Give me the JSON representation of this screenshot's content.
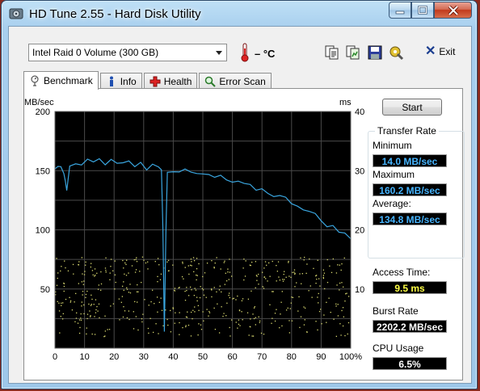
{
  "window": {
    "title": "HD Tune 2.55 - Hard Disk Utility"
  },
  "toolbar": {
    "drive": "Intel   Raid 0 Volume (300 GB)",
    "temperature": "– °C",
    "exit_label": "Exit",
    "icons": [
      "copy-text-icon",
      "copy-image-icon",
      "save-icon",
      "options-icon"
    ]
  },
  "tabs": [
    {
      "label": "Benchmark",
      "icon": "benchmark-icon",
      "active": true
    },
    {
      "label": "Info",
      "icon": "info-icon",
      "active": false
    },
    {
      "label": "Health",
      "icon": "health-icon",
      "active": false
    },
    {
      "label": "Error Scan",
      "icon": "error-scan-icon",
      "active": false
    }
  ],
  "benchmark": {
    "start_label": "Start",
    "transfer_rate_title": "Transfer Rate",
    "minimum_label": "Minimum",
    "minimum_value": "14.0 MB/sec",
    "maximum_label": "Maximum",
    "maximum_value": "160.2 MB/sec",
    "average_label": "Average:",
    "average_value": "134.8 MB/sec",
    "access_time_label": "Access Time:",
    "access_time_value": "9.5 ms",
    "burst_rate_label": "Burst Rate",
    "burst_rate_value": "2202.2 MB/sec",
    "cpu_usage_label": "CPU Usage",
    "cpu_usage_value": "6.5%"
  },
  "chart_data": {
    "type": "line",
    "left_axis_unit": "MB/sec",
    "right_axis_unit": "ms",
    "left_ticks": [
      "200",
      "150",
      "100",
      "50"
    ],
    "right_ticks": [
      "40",
      "30",
      "20",
      "10"
    ],
    "x_ticks": [
      "0",
      "10",
      "20",
      "30",
      "40",
      "50",
      "60",
      "70",
      "80",
      "90",
      "100%"
    ],
    "ylim_left": [
      0,
      200
    ],
    "ylim_right": [
      0,
      40
    ],
    "xlim": [
      0,
      100
    ],
    "grid": true,
    "colors": {
      "background": "#000000",
      "grid": "#4a4a4a",
      "transfer": "#3aa6e0",
      "access": "#d8d870"
    },
    "transfer_series": {
      "x": [
        0,
        1,
        2,
        3,
        3.5,
        4,
        5,
        7,
        9,
        11,
        13,
        15,
        17,
        19,
        21,
        23,
        25,
        27,
        29,
        31,
        33,
        35,
        36,
        36.5,
        37,
        37.5,
        38,
        40,
        42,
        44,
        46,
        48,
        50,
        52,
        54,
        56,
        58,
        60,
        62,
        64,
        66,
        68,
        70,
        72,
        74,
        76,
        78,
        80,
        82,
        84,
        86,
        88,
        90,
        92,
        94,
        96,
        98,
        100
      ],
      "y": [
        150,
        156,
        152,
        148,
        140,
        133,
        152,
        157,
        155,
        159,
        156,
        158,
        157,
        158,
        157,
        156,
        157,
        155,
        156,
        153,
        154,
        152,
        153,
        100,
        14,
        100,
        150,
        151,
        150,
        149,
        148,
        147,
        146,
        146,
        144,
        144,
        142,
        140,
        139,
        138,
        136,
        135,
        134,
        132,
        130,
        128,
        126,
        124,
        121,
        119,
        115,
        112,
        108,
        105,
        102,
        99,
        96,
        92
      ]
    },
    "access_series": {
      "note_range_ms": [
        0,
        15.5
      ]
    }
  }
}
